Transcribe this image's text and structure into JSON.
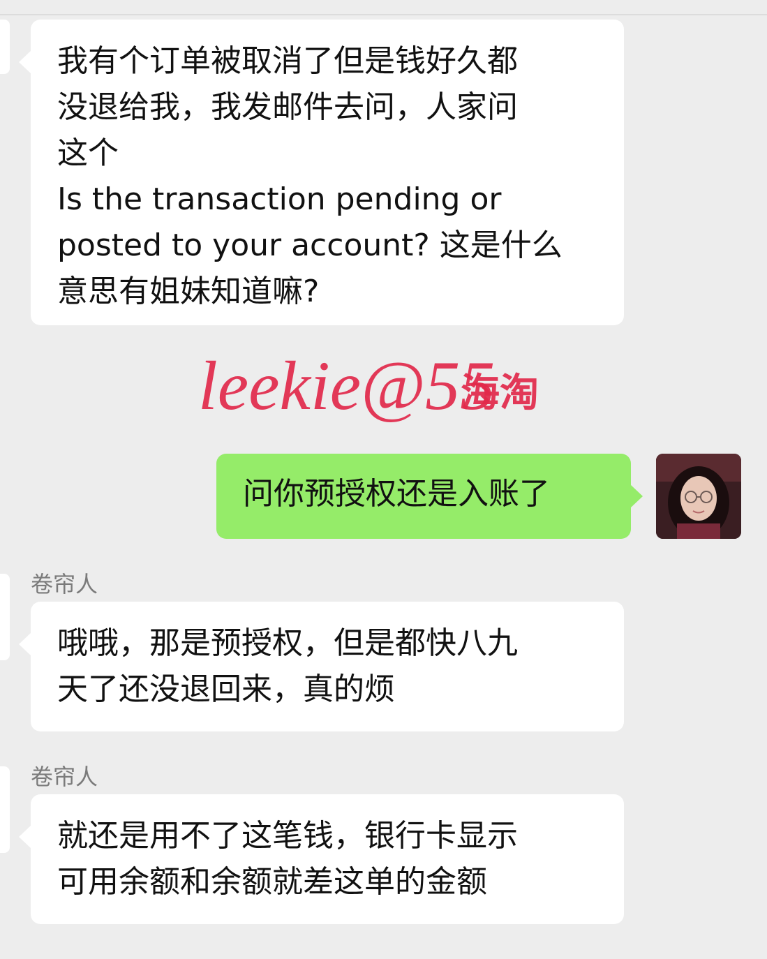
{
  "messages": [
    {
      "side": "left",
      "lines": [
        "我有个订单被取消了但是钱好久都",
        "没退给我，我发邮件去问，人家问",
        "这个",
        "Is the transaction pending or",
        "posted to your account? 这是什么",
        "意思有姐妹知道嘛?"
      ]
    },
    {
      "side": "right",
      "lines": [
        "问你预授权还是入账了"
      ]
    },
    {
      "side": "left",
      "sender": "卷帘人",
      "lines": [
        "哦哦，那是预授权，但是都快八九",
        "天了还没退回来，真的烦"
      ]
    },
    {
      "side": "left",
      "sender": "卷帘人",
      "lines": [
        "就还是用不了这笔钱，银行卡显示",
        "可用余额和余额就差这单的金额"
      ]
    }
  ],
  "watermark": {
    "script": "leekie@55",
    "suffix": "海淘",
    "color": "#e2294b"
  },
  "colors": {
    "background": "#ededed",
    "incoming_bubble": "#ffffff",
    "outgoing_bubble": "#95ec69"
  }
}
